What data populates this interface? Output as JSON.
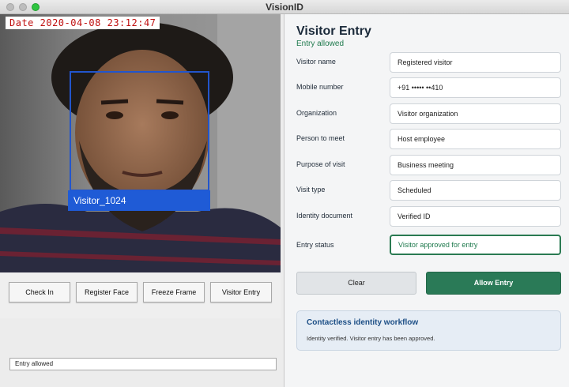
{
  "window": {
    "title": "VisionID"
  },
  "camera": {
    "date_text": "Date 2020-04-08 23:12:47",
    "face_label": "Visitor_1024"
  },
  "toolbar": {
    "check_in": "Check In",
    "register_face": "Register Face",
    "freeze_frame": "Freeze Frame",
    "visitor_entry": "Visitor Entry"
  },
  "status_bar": {
    "text": "Entry allowed"
  },
  "form": {
    "title": "Visitor Entry",
    "subtitle": "Entry allowed",
    "fields": [
      {
        "label": "Visitor name",
        "value": "Registered visitor"
      },
      {
        "label": "Mobile number",
        "value": "+91 ••••• ••410"
      },
      {
        "label": "Organization",
        "value": "Visitor organization"
      },
      {
        "label": "Person to meet",
        "value": "Host employee"
      },
      {
        "label": "Purpose of visit",
        "value": "Business meeting"
      },
      {
        "label": "Visit type",
        "value": "Scheduled"
      },
      {
        "label": "Identity document",
        "value": "Verified ID"
      },
      {
        "label": "Entry status",
        "value": "Visitor approved for entry"
      }
    ],
    "clear_label": "Clear",
    "allow_label": "Allow Entry"
  },
  "info": {
    "title": "Contactless identity workflow",
    "body": "Identity verified. Visitor entry has been approved."
  },
  "colors": {
    "accent_green": "#2a7a57",
    "face_box_blue": "#1f5bd6",
    "info_title_blue": "#1d4f86",
    "date_red": "#c01010"
  }
}
